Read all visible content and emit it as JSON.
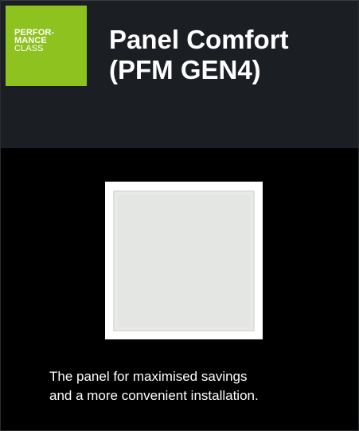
{
  "badge": {
    "line1": "PERFOR-",
    "line2": "MANCE",
    "line3": "CLASS",
    "color": "#8dc21f"
  },
  "header": {
    "title_line1": "Panel Comfort",
    "title_line2": "(PFM GEN4)",
    "background": "#1b1e22"
  },
  "product": {
    "icon": "led-panel-image"
  },
  "description": {
    "line1": "The panel for maximised savings",
    "line2": "and a more convenient installation."
  }
}
